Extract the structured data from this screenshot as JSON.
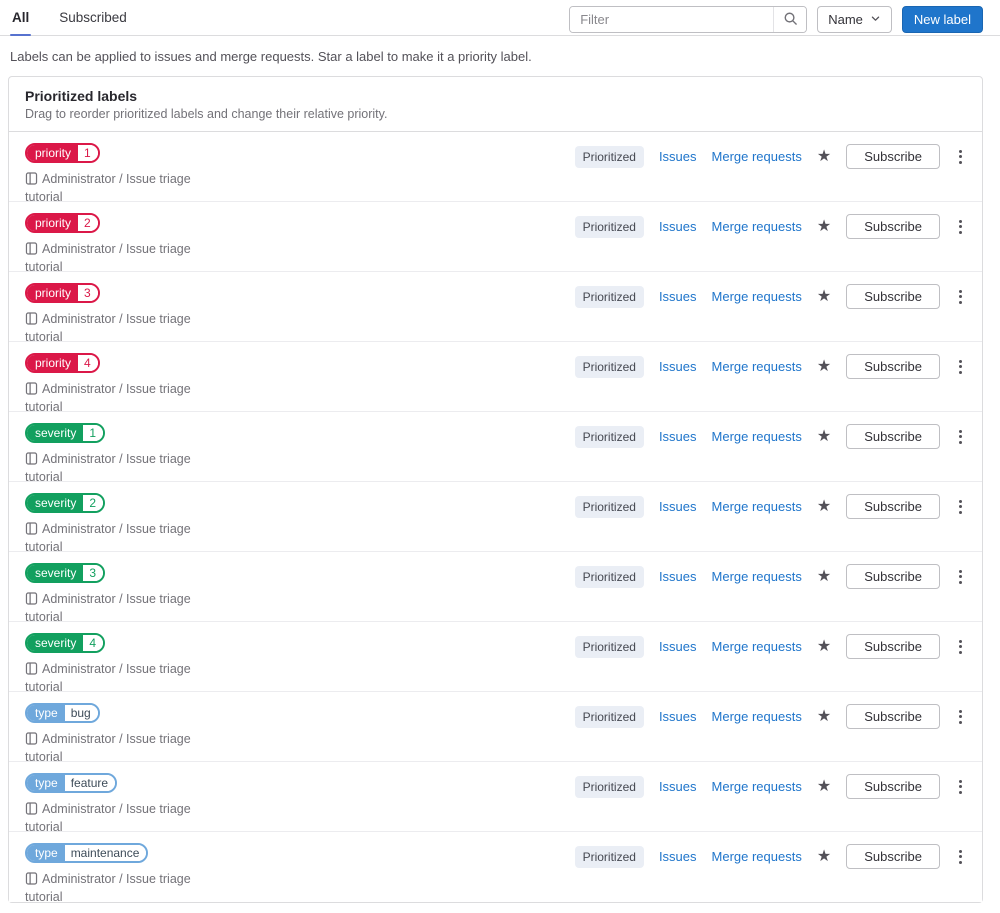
{
  "tabs": [
    {
      "label": "All",
      "active": true
    },
    {
      "label": "Subscribed",
      "active": false
    }
  ],
  "filter": {
    "placeholder": "Filter"
  },
  "sort": {
    "label": "Name"
  },
  "new_label_button": "New label",
  "page_description": "Labels can be applied to issues and merge requests. Star a label to make it a priority label.",
  "card": {
    "title": "Prioritized labels",
    "subtitle": "Drag to reorder prioritized labels and change their relative priority."
  },
  "row_common": {
    "badge": "Prioritized",
    "issues_link": "Issues",
    "merge_requests_link": "Merge requests",
    "subscribe_button": "Subscribe",
    "project": "Administrator / Issue triage tutorial"
  },
  "labels": [
    {
      "scope": "priority",
      "value": "1",
      "color": "#db1848",
      "value_color": "#db1848"
    },
    {
      "scope": "priority",
      "value": "2",
      "color": "#db1848",
      "value_color": "#db1848"
    },
    {
      "scope": "priority",
      "value": "3",
      "color": "#db1848",
      "value_color": "#db1848"
    },
    {
      "scope": "priority",
      "value": "4",
      "color": "#db1848",
      "value_color": "#db1848"
    },
    {
      "scope": "severity",
      "value": "1",
      "color": "#12a05f",
      "value_color": "#12a05f"
    },
    {
      "scope": "severity",
      "value": "2",
      "color": "#12a05f",
      "value_color": "#12a05f"
    },
    {
      "scope": "severity",
      "value": "3",
      "color": "#12a05f",
      "value_color": "#12a05f"
    },
    {
      "scope": "severity",
      "value": "4",
      "color": "#12a05f",
      "value_color": "#12a05f"
    },
    {
      "scope": "type",
      "value": "bug",
      "color": "#6fa8dc",
      "value_color": "#3e4c59"
    },
    {
      "scope": "type",
      "value": "feature",
      "color": "#6fa8dc",
      "value_color": "#3e4c59"
    },
    {
      "scope": "type",
      "value": "maintenance",
      "color": "#6fa8dc",
      "value_color": "#3e4c59"
    }
  ],
  "icons": {
    "search": "magnifying-glass",
    "chevron_down": "chevron-down",
    "project": "project-book",
    "star": "filled-star",
    "kebab": "vertical-ellipsis"
  },
  "colors": {
    "accent_blue": "#1f75cb",
    "tab_underline": "#5772cf",
    "priority_red": "#db1848",
    "severity_green": "#12a05f",
    "type_blue": "#6fa8dc",
    "badge_bg": "#eaeef5",
    "border": "#dcdcde"
  }
}
